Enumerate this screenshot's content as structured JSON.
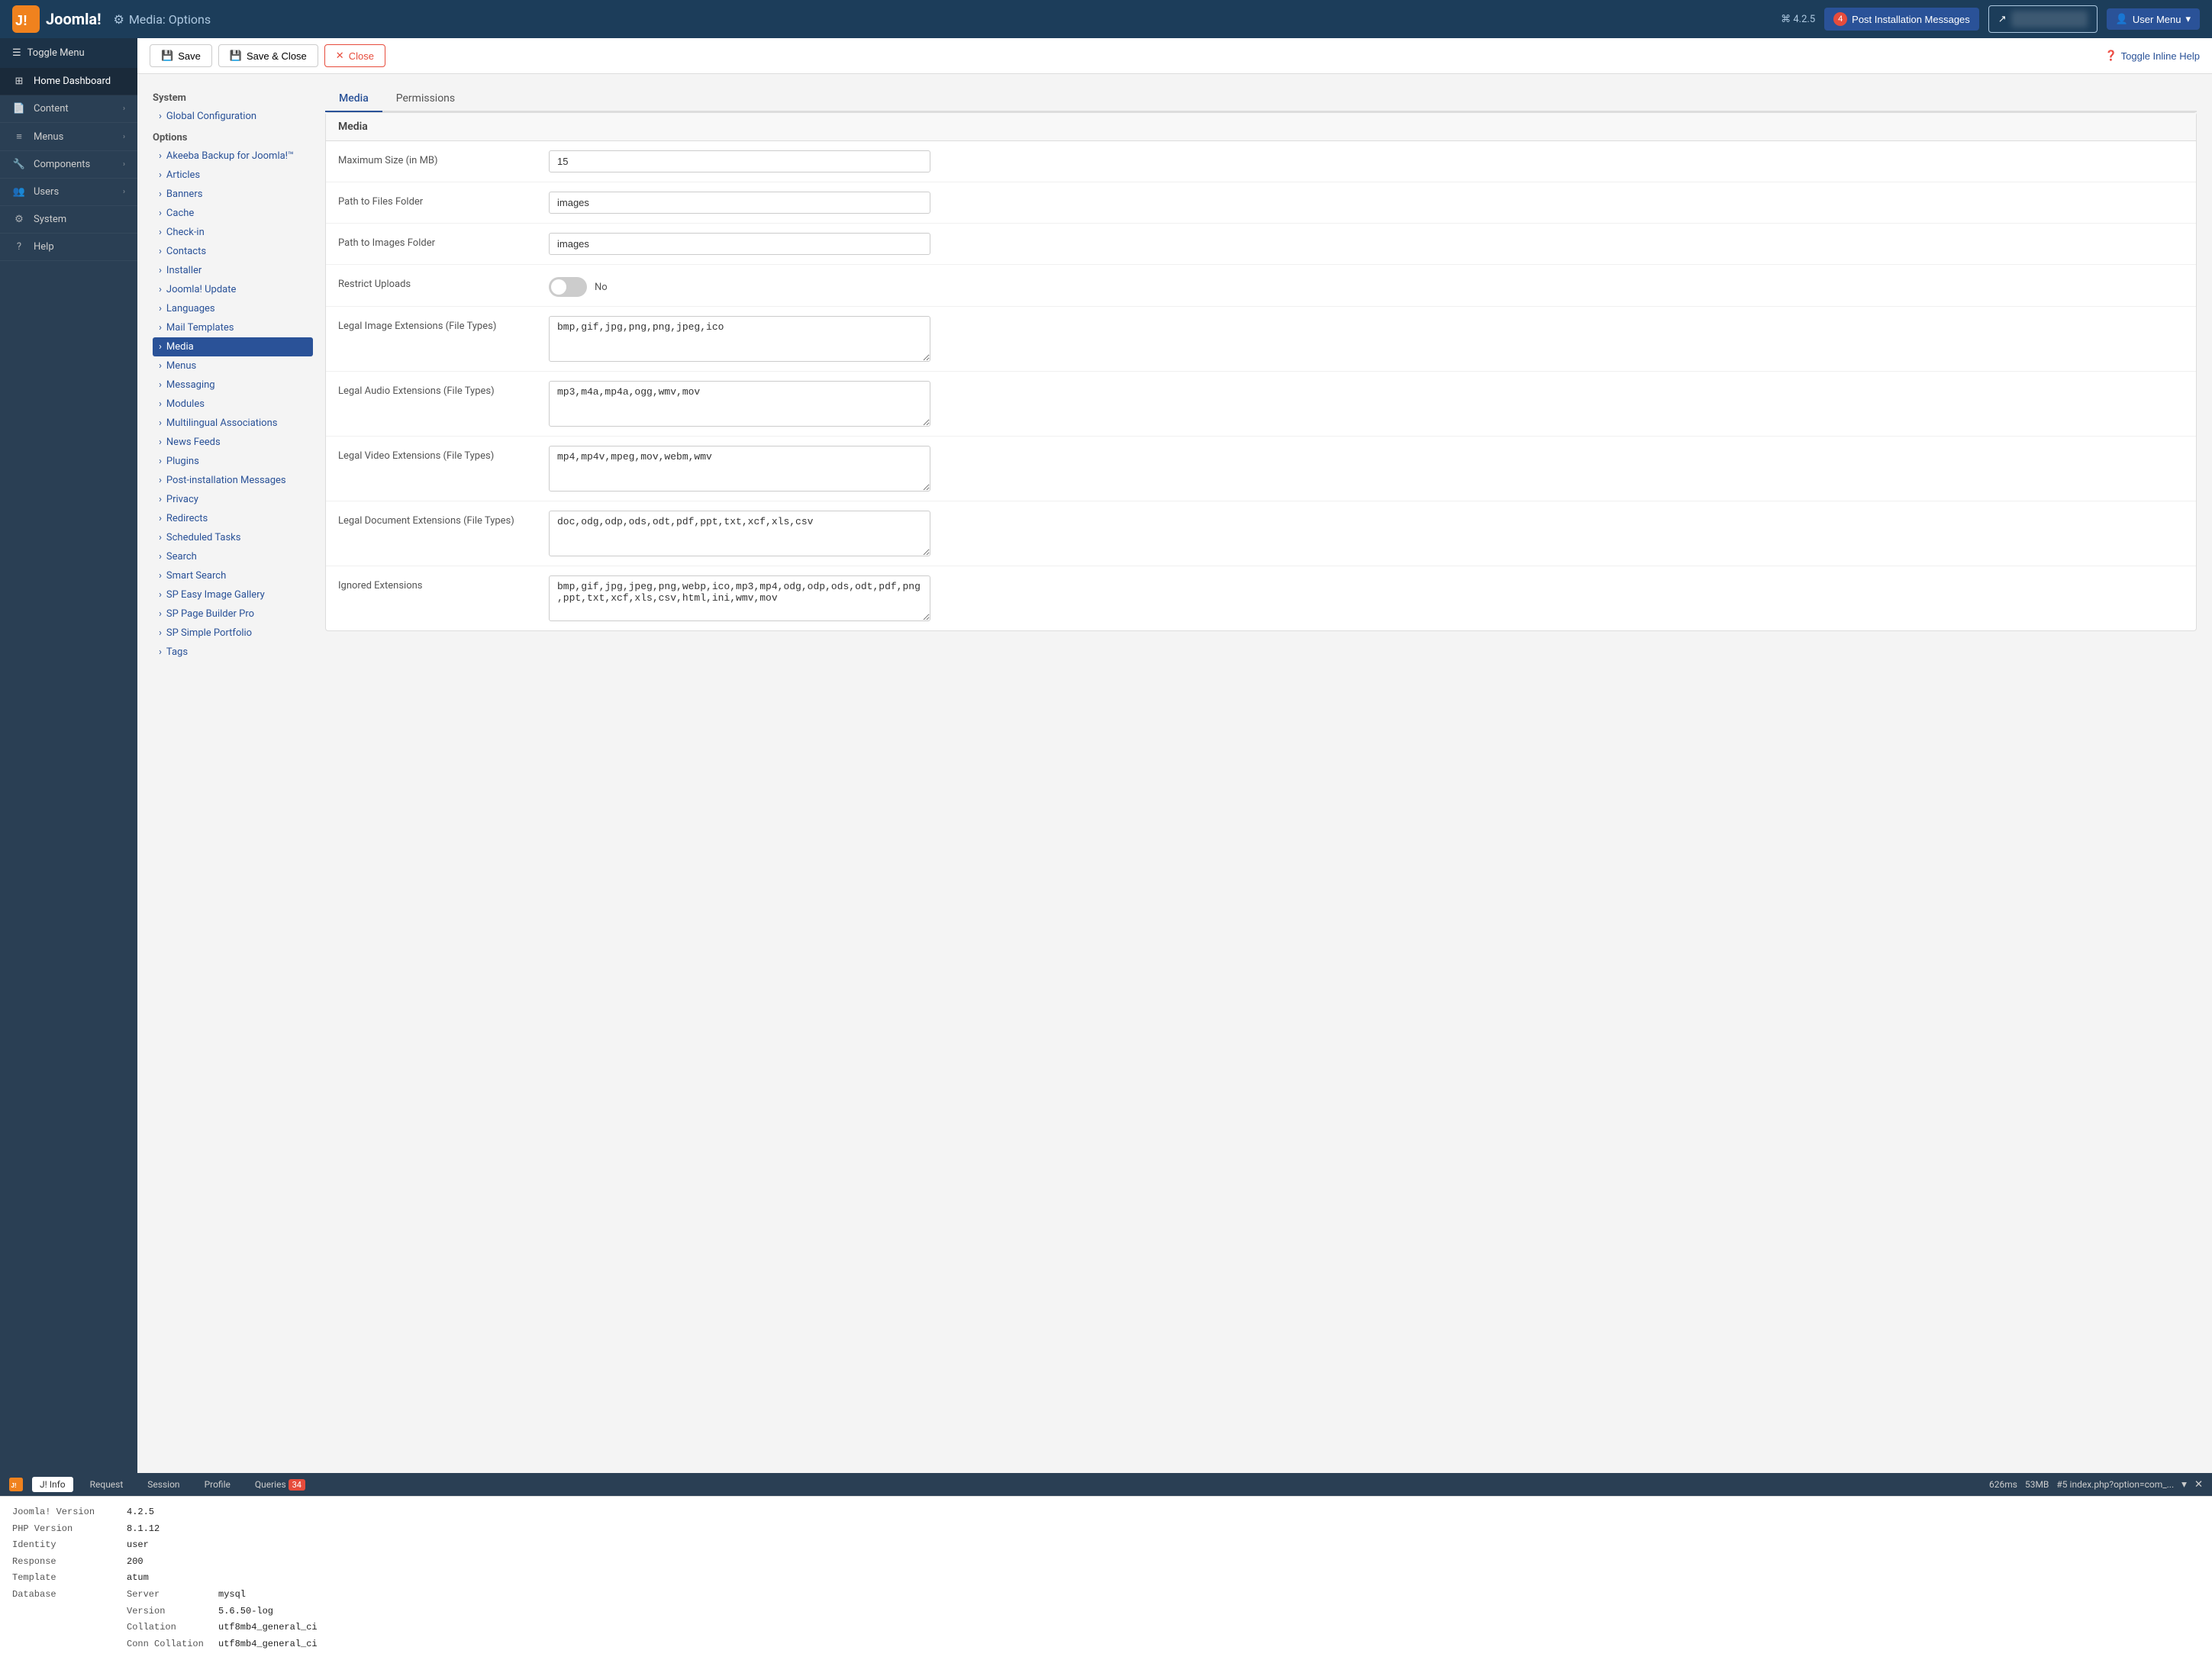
{
  "navbar": {
    "logo_text": "Joomla!",
    "title": "Media: Options",
    "title_icon": "⚙",
    "version": "⌘ 4.2.5",
    "bell_count": "4",
    "post_install_label": "Post Installation Messages",
    "user_menu_label": "User Menu",
    "user_icon": "👤"
  },
  "sidebar": {
    "toggle_label": "Toggle Menu",
    "items": [
      {
        "id": "home-dashboard",
        "icon": "⊞",
        "label": "Home Dashboard",
        "arrow": ""
      },
      {
        "id": "content",
        "icon": "📄",
        "label": "Content",
        "arrow": "›"
      },
      {
        "id": "menus",
        "icon": "≡",
        "label": "Menus",
        "arrow": "›"
      },
      {
        "id": "components",
        "icon": "🔧",
        "label": "Components",
        "arrow": "›"
      },
      {
        "id": "users",
        "icon": "👥",
        "label": "Users",
        "arrow": "›"
      },
      {
        "id": "system",
        "icon": "⚙",
        "label": "System",
        "arrow": ""
      },
      {
        "id": "help",
        "icon": "?",
        "label": "Help",
        "arrow": ""
      }
    ]
  },
  "toolbar": {
    "save_label": "Save",
    "save_close_label": "Save & Close",
    "close_label": "Close",
    "toggle_help_label": "Toggle Inline Help"
  },
  "side_nav": {
    "system_label": "System",
    "global_config_label": "Global Configuration",
    "options_label": "Options",
    "items": [
      "Akeeba Backup for Joomla!™",
      "Articles",
      "Banners",
      "Cache",
      "Check-in",
      "Contacts",
      "Installer",
      "Joomla! Update",
      "Languages",
      "Mail Templates",
      "Media",
      "Menus",
      "Messaging",
      "Modules",
      "Multilingual Associations",
      "News Feeds",
      "Plugins",
      "Post-installation Messages",
      "Privacy",
      "Redirects",
      "Scheduled Tasks",
      "Search",
      "Smart Search",
      "SP Easy Image Gallery",
      "SP Page Builder Pro",
      "SP Simple Portfolio",
      "Tags"
    ],
    "active_item": "Media"
  },
  "tabs": [
    {
      "id": "media",
      "label": "Media",
      "active": true
    },
    {
      "id": "permissions",
      "label": "Permissions",
      "active": false
    }
  ],
  "media_section_title": "Media",
  "form_fields": [
    {
      "id": "max-size",
      "label": "Maximum Size (in MB)",
      "type": "input",
      "value": "15"
    },
    {
      "id": "path-files",
      "label": "Path to Files Folder",
      "type": "input",
      "value": "images"
    },
    {
      "id": "path-images",
      "label": "Path to Images Folder",
      "type": "input",
      "value": "images"
    },
    {
      "id": "restrict-uploads",
      "label": "Restrict Uploads",
      "type": "toggle",
      "toggle_state": "off",
      "toggle_label": "No"
    },
    {
      "id": "legal-image-ext",
      "label": "Legal Image Extensions (File Types)",
      "type": "textarea",
      "value": "bmp,gif,jpg,png,png,jpeg,ico"
    },
    {
      "id": "legal-audio-ext",
      "label": "Legal Audio Extensions (File Types)",
      "type": "textarea",
      "value": "mp3,m4a,mp4a,ogg,wmv,mov"
    },
    {
      "id": "legal-video-ext",
      "label": "Legal Video Extensions (File Types)",
      "type": "textarea",
      "value": "mp4,mp4v,mpeg,mov,webm,wmv"
    },
    {
      "id": "legal-doc-ext",
      "label": "Legal Document Extensions (File Types)",
      "type": "textarea",
      "value": "doc,odg,odp,ods,odt,pdf,ppt,txt,xcf,xls,csv"
    },
    {
      "id": "ignored-ext",
      "label": "Ignored Extensions",
      "type": "textarea",
      "value": "bmp,gif,jpg,jpeg,png,webp,ico,mp3,mp4,odg,odp,ods,odt,pdf,png,ppt,txt,xcf,xls,csv,html,ini,wmv,mov"
    }
  ],
  "debug_bar": {
    "tabs": [
      "J! Info",
      "Request",
      "Session",
      "Profile",
      "Queries"
    ],
    "active_tab": "J! Info",
    "queries_count": "34",
    "time": "626ms",
    "memory": "53MB",
    "page_info": "#5 index.php?option=com_..."
  },
  "debug_info": {
    "joomla_version_label": "Joomla! Version",
    "joomla_version_value": "4.2.5",
    "php_version_label": "PHP Version",
    "php_version_value": "8.1.12",
    "identity_label": "Identity",
    "identity_value": "user",
    "response_label": "Response",
    "response_value": "200",
    "template_label": "Template",
    "template_value": "atum",
    "database_label": "Database",
    "db_server_label": "Server",
    "db_server_value": "mysql",
    "db_version_label": "Version",
    "db_version_value": "5.6.50-log",
    "db_collation_label": "Collation",
    "db_collation_value": "utf8mb4_general_ci",
    "db_conn_collation_label": "Conn Collation",
    "db_conn_collation_value": "utf8mb4_general_ci"
  }
}
